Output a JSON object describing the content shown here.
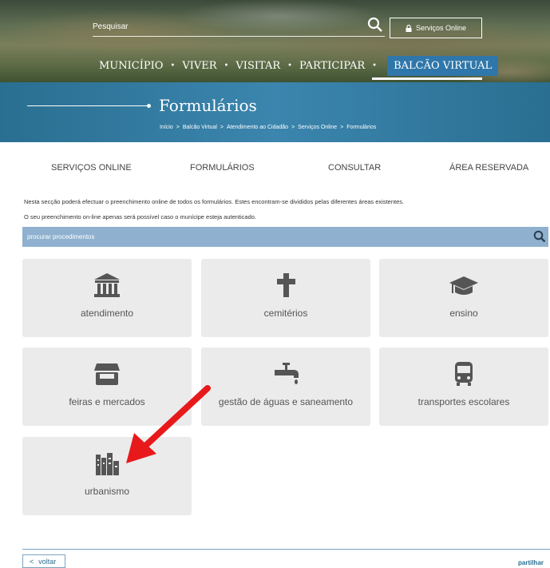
{
  "header": {
    "search_placeholder": "Pesquisar",
    "servicos_button": "Serviços Online",
    "nav": [
      "MUNICÍPIO",
      "VIVER",
      "VISITAR",
      "PARTICIPAR",
      "BALCÃO VIRTUAL"
    ],
    "nav_separator": "•"
  },
  "banner": {
    "title": "Formulários",
    "breadcrumb": [
      "Início",
      "Balcão Virtual",
      "Atendimento ao Cidadão",
      "Serviços Online",
      "Formulários"
    ],
    "breadcrumb_separator": ">"
  },
  "tabs": [
    "SERVIÇOS ONLINE",
    "FORMULÁRIOS",
    "CONSULTAR",
    "ÁREA RESERVADA"
  ],
  "intro": {
    "line1": "Nesta secção poderá efectuar o preenchimento online de todos os formulários. Estes encontram-se divididos pelas diferentes áreas existentes.",
    "line2": "O seu preenchimento on-line apenas será possível caso o munícipe esteja autenticado."
  },
  "procedure_search": {
    "placeholder": "procurar procedimentos"
  },
  "tiles": [
    {
      "label": "atendimento",
      "icon": "institution-icon"
    },
    {
      "label": "cemitérios",
      "icon": "cross-icon"
    },
    {
      "label": "ensino",
      "icon": "graduation-cap-icon"
    },
    {
      "label": "feiras e mercados",
      "icon": "store-icon"
    },
    {
      "label": "gestão de águas e saneamento",
      "icon": "faucet-icon"
    },
    {
      "label": "transportes escolares",
      "icon": "bus-icon"
    },
    {
      "label": "urbanismo",
      "icon": "industry-icon"
    }
  ],
  "footer": {
    "back": "voltar",
    "share": "partilhar"
  },
  "colors": {
    "nav_active": "#2f77aa",
    "banner": "#3b85ae",
    "search_bar": "#8fb1cf",
    "tile_bg": "#ebebeb",
    "icon": "#555555",
    "arrow": "#e8191b"
  }
}
